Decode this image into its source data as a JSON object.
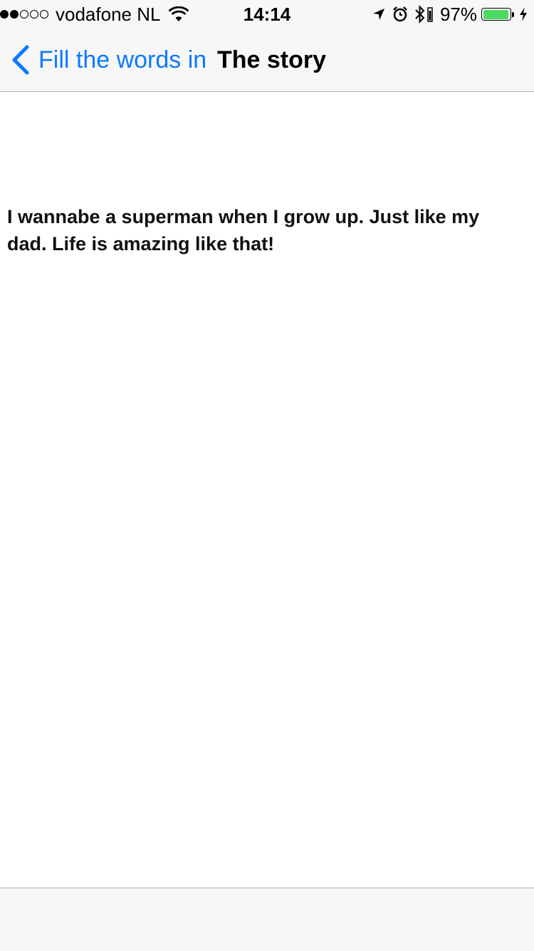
{
  "status_bar": {
    "signal_filled": 2,
    "signal_total": 5,
    "carrier": "vodafone NL",
    "time": "14:14",
    "battery_percent": "97%",
    "battery_level": 0.97,
    "battery_color": "#4cd964",
    "icons": [
      "signal-icon",
      "wifi-icon",
      "location-arrow-icon",
      "alarm-icon",
      "bluetooth-icon",
      "battery-icon",
      "charging-bolt-icon"
    ]
  },
  "nav_bar": {
    "back_label": "Fill the words in",
    "title": "The story",
    "accent_color": "#0a7aff"
  },
  "content": {
    "story": "I wannabe a superman when I grow up. Just like my dad. Life is amazing like that!"
  }
}
